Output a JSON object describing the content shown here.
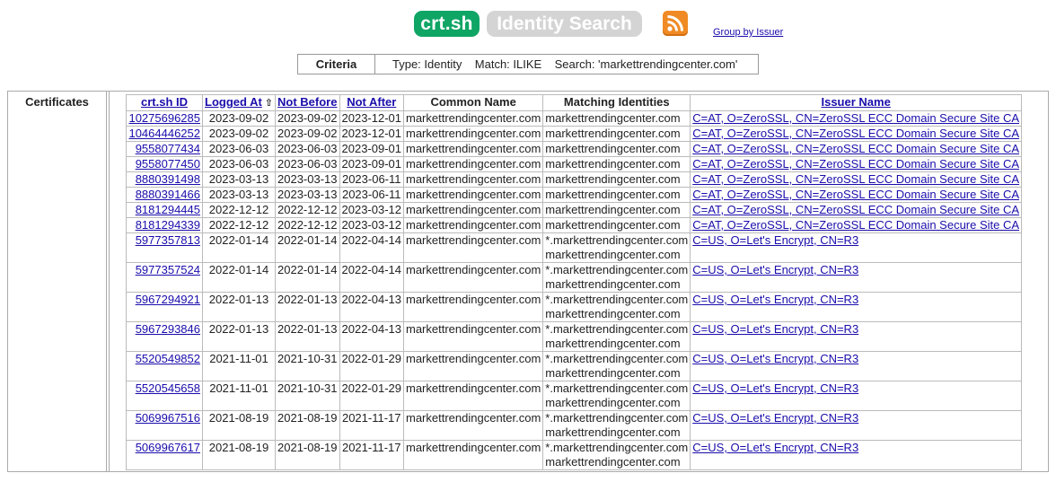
{
  "header": {
    "logo_primary": "crt.sh",
    "logo_secondary": "Identity Search",
    "group_link": "Group by Issuer"
  },
  "criteria": {
    "label": "Criteria",
    "text": "Type: Identity    Match: ILIKE    Search: 'markettrendingcenter.com'"
  },
  "section_label": "Certificates",
  "table": {
    "headers": {
      "id": "crt.sh ID",
      "logged_at": "Logged At",
      "sort_icon": "⇧",
      "not_before": "Not Before",
      "not_after": "Not After",
      "common_name": "Common Name",
      "matching": "Matching Identities",
      "issuer": "Issuer Name"
    },
    "rows": [
      {
        "id": "10275696285",
        "logged": "2023-09-02",
        "nb": "2023-09-02",
        "na": "2023-12-01",
        "cn": "markettrendingcenter.com",
        "m1": "markettrendingcenter.com",
        "m2": "",
        "issuer": "C=AT, O=ZeroSSL, CN=ZeroSSL ECC Domain Secure Site CA"
      },
      {
        "id": "10464446252",
        "logged": "2023-09-02",
        "nb": "2023-09-02",
        "na": "2023-12-01",
        "cn": "markettrendingcenter.com",
        "m1": "markettrendingcenter.com",
        "m2": "",
        "issuer": "C=AT, O=ZeroSSL, CN=ZeroSSL ECC Domain Secure Site CA"
      },
      {
        "id": "9558077434",
        "logged": "2023-06-03",
        "nb": "2023-06-03",
        "na": "2023-09-01",
        "cn": "markettrendingcenter.com",
        "m1": "markettrendingcenter.com",
        "m2": "",
        "issuer": "C=AT, O=ZeroSSL, CN=ZeroSSL ECC Domain Secure Site CA"
      },
      {
        "id": "9558077450",
        "logged": "2023-06-03",
        "nb": "2023-06-03",
        "na": "2023-09-01",
        "cn": "markettrendingcenter.com",
        "m1": "markettrendingcenter.com",
        "m2": "",
        "issuer": "C=AT, O=ZeroSSL, CN=ZeroSSL ECC Domain Secure Site CA"
      },
      {
        "id": "8880391498",
        "logged": "2023-03-13",
        "nb": "2023-03-13",
        "na": "2023-06-11",
        "cn": "markettrendingcenter.com",
        "m1": "markettrendingcenter.com",
        "m2": "",
        "issuer": "C=AT, O=ZeroSSL, CN=ZeroSSL ECC Domain Secure Site CA"
      },
      {
        "id": "8880391466",
        "logged": "2023-03-13",
        "nb": "2023-03-13",
        "na": "2023-06-11",
        "cn": "markettrendingcenter.com",
        "m1": "markettrendingcenter.com",
        "m2": "",
        "issuer": "C=AT, O=ZeroSSL, CN=ZeroSSL ECC Domain Secure Site CA"
      },
      {
        "id": "8181294445",
        "logged": "2022-12-12",
        "nb": "2022-12-12",
        "na": "2023-03-12",
        "cn": "markettrendingcenter.com",
        "m1": "markettrendingcenter.com",
        "m2": "",
        "issuer": "C=AT, O=ZeroSSL, CN=ZeroSSL ECC Domain Secure Site CA"
      },
      {
        "id": "8181294339",
        "logged": "2022-12-12",
        "nb": "2022-12-12",
        "na": "2023-03-12",
        "cn": "markettrendingcenter.com",
        "m1": "markettrendingcenter.com",
        "m2": "",
        "issuer": "C=AT, O=ZeroSSL, CN=ZeroSSL ECC Domain Secure Site CA"
      },
      {
        "id": "5977357813",
        "logged": "2022-01-14",
        "nb": "2022-01-14",
        "na": "2022-04-14",
        "cn": "markettrendingcenter.com",
        "m1": "*.markettrendingcenter.com",
        "m2": "markettrendingcenter.com",
        "issuer": "C=US, O=Let's Encrypt, CN=R3"
      },
      {
        "id": "5977357524",
        "logged": "2022-01-14",
        "nb": "2022-01-14",
        "na": "2022-04-14",
        "cn": "markettrendingcenter.com",
        "m1": "*.markettrendingcenter.com",
        "m2": "markettrendingcenter.com",
        "issuer": "C=US, O=Let's Encrypt, CN=R3"
      },
      {
        "id": "5967294921",
        "logged": "2022-01-13",
        "nb": "2022-01-13",
        "na": "2022-04-13",
        "cn": "markettrendingcenter.com",
        "m1": "*.markettrendingcenter.com",
        "m2": "markettrendingcenter.com",
        "issuer": "C=US, O=Let's Encrypt, CN=R3"
      },
      {
        "id": "5967293846",
        "logged": "2022-01-13",
        "nb": "2022-01-13",
        "na": "2022-04-13",
        "cn": "markettrendingcenter.com",
        "m1": "*.markettrendingcenter.com",
        "m2": "markettrendingcenter.com",
        "issuer": "C=US, O=Let's Encrypt, CN=R3"
      },
      {
        "id": "5520549852",
        "logged": "2021-11-01",
        "nb": "2021-10-31",
        "na": "2022-01-29",
        "cn": "markettrendingcenter.com",
        "m1": "*.markettrendingcenter.com",
        "m2": "markettrendingcenter.com",
        "issuer": "C=US, O=Let's Encrypt, CN=R3"
      },
      {
        "id": "5520545658",
        "logged": "2021-11-01",
        "nb": "2021-10-31",
        "na": "2022-01-29",
        "cn": "markettrendingcenter.com",
        "m1": "*.markettrendingcenter.com",
        "m2": "markettrendingcenter.com",
        "issuer": "C=US, O=Let's Encrypt, CN=R3"
      },
      {
        "id": "5069967516",
        "logged": "2021-08-19",
        "nb": "2021-08-19",
        "na": "2021-11-17",
        "cn": "markettrendingcenter.com",
        "m1": "*.markettrendingcenter.com",
        "m2": "markettrendingcenter.com",
        "issuer": "C=US, O=Let's Encrypt, CN=R3"
      },
      {
        "id": "5069967617",
        "logged": "2021-08-19",
        "nb": "2021-08-19",
        "na": "2021-11-17",
        "cn": "markettrendingcenter.com",
        "m1": "*.markettrendingcenter.com",
        "m2": "markettrendingcenter.com",
        "issuer": "C=US, O=Let's Encrypt, CN=R3"
      }
    ]
  },
  "colors": {
    "logo_green": "#0fa565",
    "logo_gray": "#d4d4d4",
    "rss_orange": "#f08a24",
    "link": "#1a0dab"
  },
  "icons": {
    "rss": "rss-feed-icon",
    "sort": "sort-ascending-icon"
  }
}
